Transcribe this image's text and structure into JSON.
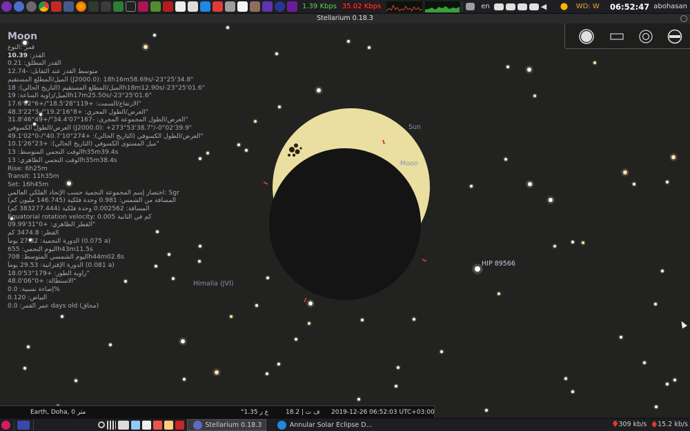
{
  "top_panel": {
    "upload_rate": "1.39 Kbps",
    "download_rate": "35.02 Kbps",
    "keyboard_layout": "en",
    "weather": "WD: W",
    "clock": "06:52:47",
    "user": "abohasan",
    "icons": [
      "app-menu-icon",
      "places-icon",
      "settings-icon",
      "chrome-icon",
      "red-app-icon",
      "files-icon",
      "firefox-icon",
      "terminal-icon",
      "monitor-icon",
      "spreadsheet-icon",
      "terminal2-icon",
      "drawing-icon",
      "book-icon",
      "presentation-icon",
      "calendar-icon",
      "camera-icon",
      "mail-icon",
      "pdf-icon",
      "scanner-icon",
      "notes-icon",
      "app-icon",
      "game-icon",
      "stellarium-icon",
      "ide-icon"
    ]
  },
  "window": {
    "title": "Stellarium 0.18.3"
  },
  "info_panel": {
    "object_name": "Moon",
    "rows": [
      "قمر :النوع",
      "القدر: <b>10.39</b>",
      "القدر المطلق: 0.21",
      "متوسط القدر عند التقابل: -12.74",
      "الميل/المطلع المستقيم (J2000.0): 18h16m58.69s/-23°25'34.8\"",
      "الميل/المطلع المستقيم (التاريخ الحالي): 18h18m12.90s/-23°25'01.6\"",
      "الميل/زاوية الساعة: 19h17m25.50s/-23°25'01.6\"",
      "الارتفاع/السمت: +119°28'18.5\"/+6°02'17.6\"",
      "العرض/الطول المجري: +8°16'19.2\"/-3°22'48.3\"",
      "العرض/الطول المجموعة المجرى: -167°07'34.4\"/+49°46'31.8\"",
      "العرض/الطول الكسوفي (J2000.0): +273°53'38.7\"/-0°02'39.9\"",
      "العرض/الطول الكسوفي (التاريخ الحالي): +274°10'40.7\"/-0°02'49.1\"",
      "ميل المستوى الكسوفي (التاريخ الحالي): +23°26'10.1\"",
      "الوقت النجمي المتوسط: 13h35m39.4s",
      "الوقت النجمي الظاهري: 13h35m38.4s",
      "Rise: 6h25m",
      "Transit: 11h35m",
      "Set: 16h45m",
      "اختصار إسم المجموعة النجمية حسب الإتحاد الفلكي العالمي: Sgr",
      "المسافة من الشمس: 0.981 وحدة فلكية (146.745 مليون كم)",
      "المسافة: 0.002562 وحدة فلكية (383277.444 كم)",
      "Equatorial rotation velocity: 0.005 كم في الثانية",
      "القطر الظاهري: +0°31'09.99\"",
      "القطر: 3474.8 كم",
      "الدورة النجمية: 27.32 يوماً (0.075 a)",
      "اليوم النجمي: 655h43m11.5s",
      "اليوم الشمسي المتوسط: 708h44m02.8s",
      "الدورة الإقترانية: 29.53 يوماً (0.081 a)",
      "زاوية الطور: +179°53'18.0\"",
      "الاستطالة: +0°06'48.0\"",
      "إضاءة نسبية: 0.0%",
      "البياض: 0.120",
      "عمر القمر: 0.0 days old (محاق)"
    ]
  },
  "sky_labels": {
    "sun": "Sun",
    "moon": "Moon",
    "star": "HIP 89566",
    "satellite": "Himalia (JVI)"
  },
  "status_bar": {
    "location": "Earth, Doha, 0 متر",
    "fov": "°1.35 ع ر",
    "fps": "18.2 | ف ت",
    "datetime": "2019-12-26 06:52:03 UTC+03:00"
  },
  "taskbar": {
    "tasks": [
      "Stellarium 0.18.3",
      "Annular Solar Eclipse D..."
    ],
    "down_rate": "309 kb/s",
    "up_rate": "15.2 kb/s"
  }
}
